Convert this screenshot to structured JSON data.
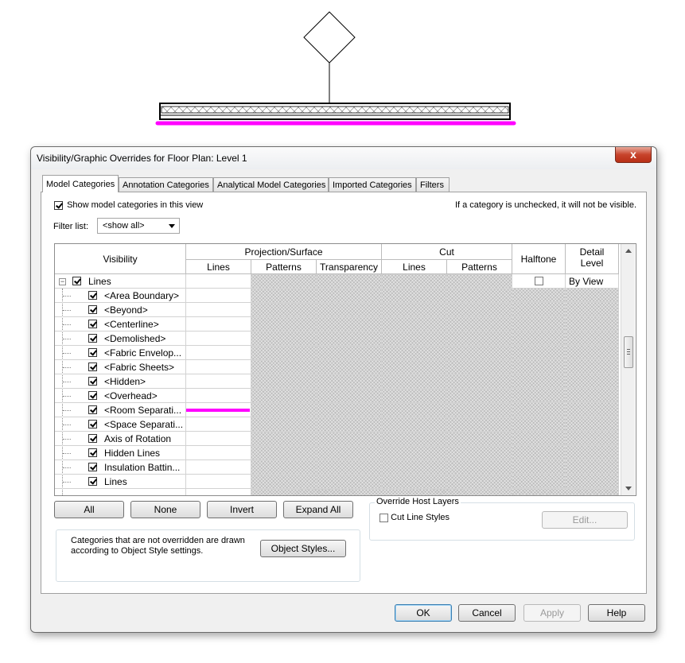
{
  "dialog": {
    "title": "Visibility/Graphic Overrides for Floor Plan: Level 1",
    "close_label": "x"
  },
  "tabs": [
    {
      "label": "Model Categories",
      "active": true
    },
    {
      "label": "Annotation Categories",
      "active": false
    },
    {
      "label": "Analytical Model Categories",
      "active": false
    },
    {
      "label": "Imported Categories",
      "active": false
    },
    {
      "label": "Filters",
      "active": false
    }
  ],
  "panel": {
    "show_model_label": "Show model categories in this view",
    "show_model_checked": true,
    "hint": "If a category is unchecked, it will not be visible.",
    "filter_label": "Filter list:",
    "filter_value": "<show all>"
  },
  "grid": {
    "headers": {
      "visibility": "Visibility",
      "projection_surface": "Projection/Surface",
      "cut": "Cut",
      "halftone": "Halftone",
      "detail_level_1": "Detail",
      "detail_level_2": "Level",
      "lines": "Lines",
      "patterns": "Patterns",
      "transparency": "Transparency",
      "cut_lines": "Lines",
      "cut_patterns": "Patterns"
    },
    "parent": {
      "name": "Lines",
      "checked": true,
      "detail_level": "By View",
      "expand_symbol": "−"
    },
    "rows": [
      {
        "name": "<Area Boundary>",
        "checked": true
      },
      {
        "name": "<Beyond>",
        "checked": true
      },
      {
        "name": "<Centerline>",
        "checked": true
      },
      {
        "name": "<Demolished>",
        "checked": true
      },
      {
        "name": "<Fabric Envelop...",
        "checked": true
      },
      {
        "name": "<Fabric Sheets>",
        "checked": true
      },
      {
        "name": "<Hidden>",
        "checked": true
      },
      {
        "name": "<Overhead>",
        "checked": true
      },
      {
        "name": "<Room Separati...",
        "checked": true,
        "line_override": true
      },
      {
        "name": "<Space Separati...",
        "checked": true
      },
      {
        "name": "Axis of Rotation",
        "checked": true
      },
      {
        "name": "Hidden Lines",
        "checked": true
      },
      {
        "name": "Insulation Battin...",
        "checked": true
      },
      {
        "name": "Lines",
        "checked": true
      }
    ],
    "override_color": "#ff00ff"
  },
  "buttons": {
    "all": "All",
    "none": "None",
    "invert": "Invert",
    "expand_all": "Expand All",
    "object_styles": "Object Styles...",
    "edit": "Edit...",
    "ok": "OK",
    "cancel": "Cancel",
    "apply": "Apply",
    "help": "Help"
  },
  "override_host": {
    "legend": "Override Host Layers",
    "cut_line_styles": "Cut Line Styles",
    "cut_line_checked": false
  },
  "info_text": "Categories that are not overridden are drawn according to Object Style settings."
}
